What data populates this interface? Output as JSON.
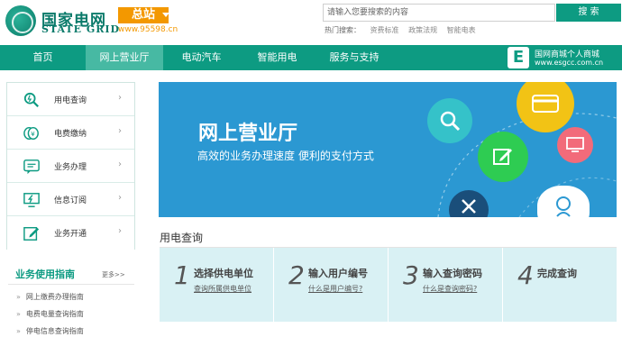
{
  "header": {
    "logo_cn": "国家电网",
    "logo_en": "STATE GRID",
    "station_label": "总站",
    "site_url": "www.95598.cn",
    "search_placeholder": "请输入您要搜索的内容",
    "search_button": "搜 索",
    "hot_label": "热门搜索：",
    "hot_links": [
      "资费标准",
      "政策法规",
      "智能电表"
    ]
  },
  "nav": {
    "items": [
      "首页",
      "网上营业厅",
      "电动汽车",
      "智能用电",
      "服务与支持"
    ],
    "active_index": 1,
    "mall_title": "国网商城个人商城",
    "mall_url": "www.esgcc.com.cn"
  },
  "sidebar": {
    "items": [
      {
        "label": "用电查询",
        "icon": "search-icon"
      },
      {
        "label": "电费缴纳",
        "icon": "coin-icon"
      },
      {
        "label": "业务办理",
        "icon": "chat-icon"
      },
      {
        "label": "信息订阅",
        "icon": "monitor-bolt-icon"
      },
      {
        "label": "业务开通",
        "icon": "edit-icon"
      }
    ],
    "arrow": "›"
  },
  "guide": {
    "title": "业务使用指南",
    "more": "更多>>",
    "items": [
      "网上缴费办理指南",
      "电费电量查询指南",
      "停电信息查询指南"
    ]
  },
  "banner": {
    "title": "网上营业厅",
    "subtitle": "高效的业务办理速度  便利的支付方式"
  },
  "query": {
    "heading": "用电查询",
    "steps": [
      {
        "num": "1",
        "title": "选择供电单位",
        "link": "查询所属供电单位"
      },
      {
        "num": "2",
        "title": "输入用户编号",
        "link": "什么是用户编号?"
      },
      {
        "num": "3",
        "title": "输入查询密码",
        "link": "什么是查询密码?"
      },
      {
        "num": "4",
        "title": "完成查询",
        "link": ""
      }
    ]
  },
  "colors": {
    "brand_green": "#0d9b82",
    "nav_active": "#47b9a3",
    "banner_blue": "#2b98d2",
    "station_orange": "#f39800",
    "steps_bg": "#d9f1f4"
  }
}
